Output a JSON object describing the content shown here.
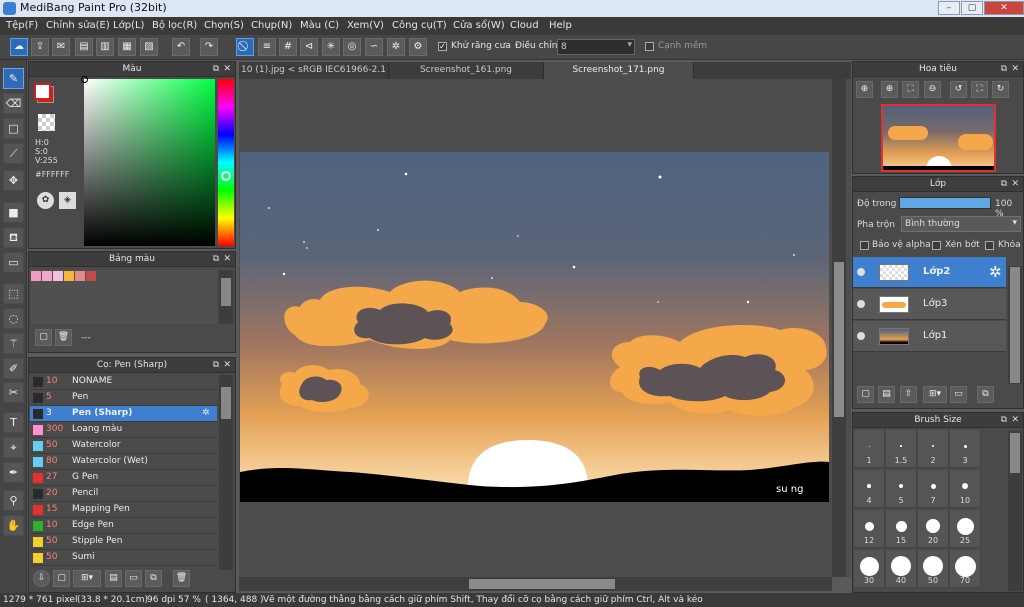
{
  "window": {
    "title": "MediBang Paint Pro (32bit)"
  },
  "menu": [
    "Tệp(F)",
    "Chỉnh sửa(E)",
    "Lớp(L)",
    "Bộ lọc(R)",
    "Chọn(S)",
    "Chụp(N)",
    "Màu (C)",
    "Xem(V)",
    "Công cụ(T)",
    "Cửa sổ(W)",
    "Cloud",
    "Help"
  ],
  "toolbar": {
    "antialias_label": "Khử răng cưa",
    "adjust_label": "Điều chỉnh",
    "adjust_value": "8",
    "soft_edge_label": "Cạnh mềm"
  },
  "color_panel": {
    "title": "Màu",
    "h": "H:0",
    "s": "S:0",
    "v": "V:255",
    "hex": "#FFFFFF",
    "primary_color": "#ffffff",
    "secondary_color": "#d21d1d"
  },
  "palette_panel": {
    "title": "Bảng màu",
    "name": "---",
    "swatches": [
      "#f59ac4",
      "#f2a6c8",
      "#f6c0dd",
      "#f5b73a",
      "#e48b8b",
      "#c04b4b"
    ]
  },
  "brush_panel": {
    "title": "Cọ: Pen (Sharp)",
    "rows": [
      {
        "size": "10",
        "name": "NONAME",
        "color": "#2a2a2a"
      },
      {
        "size": "5",
        "name": "Pen",
        "color": "#2a2a2a"
      },
      {
        "size": "3",
        "name": "Pen (Sharp)",
        "color": "#2a2a2a"
      },
      {
        "size": "300",
        "name": "Loang màu",
        "color": "#ff8fd0"
      },
      {
        "size": "50",
        "name": "Watercolor",
        "color": "#66ccf5"
      },
      {
        "size": "80",
        "name": "Watercolor (Wet)",
        "color": "#66ccf5"
      },
      {
        "size": "27",
        "name": "G Pen",
        "color": "#e83030"
      },
      {
        "size": "20",
        "name": "Pencil",
        "color": "#2a2a2a"
      },
      {
        "size": "15",
        "name": "Mapping Pen",
        "color": "#e83030"
      },
      {
        "size": "10",
        "name": "Edge Pen",
        "color": "#2fb12f"
      },
      {
        "size": "50",
        "name": "Stipple Pen",
        "color": "#f2d02a"
      },
      {
        "size": "50",
        "name": "Sumi",
        "color": "#f2d02a"
      }
    ]
  },
  "tabs": [
    "10 (1).jpg < sRGB IEC61966-2.1 >",
    "Screenshot_161.png",
    "Screenshot_171.png"
  ],
  "canvas": {
    "signature": "su ng"
  },
  "navigator": {
    "title": "Hoa tiêu"
  },
  "layer_panel": {
    "title": "Lớp",
    "opacity_label": "Độ trong",
    "opacity_value": "100 %",
    "blend_label": "Pha trộn",
    "blend_value": "Bình thường",
    "protect_alpha": "Bảo vệ alpha",
    "clipping": "Xén bớt",
    "lock": "Khóa",
    "layers": [
      {
        "name": "Lớp2"
      },
      {
        "name": "Lớp3"
      },
      {
        "name": "Lớp1"
      }
    ]
  },
  "brush_size_panel": {
    "title": "Brush Size",
    "sizes": [
      "1",
      "1.5",
      "2",
      "3",
      "4",
      "5",
      "7",
      "10",
      "12",
      "15",
      "20",
      "25",
      "30",
      "40",
      "50",
      "70"
    ]
  },
  "status": {
    "dims": "1279 * 761 pixel",
    "cm": "(33.8 * 20.1cm)",
    "dpi": "96 dpi",
    "zoom": "57 %",
    "coords": "( 1364, 488 )",
    "hint": "Vẽ một đường thẳng bằng cách giữ phím Shift, Thay đổi cỡ cọ bằng cách giữ phím Ctrl, Alt và kéo"
  }
}
